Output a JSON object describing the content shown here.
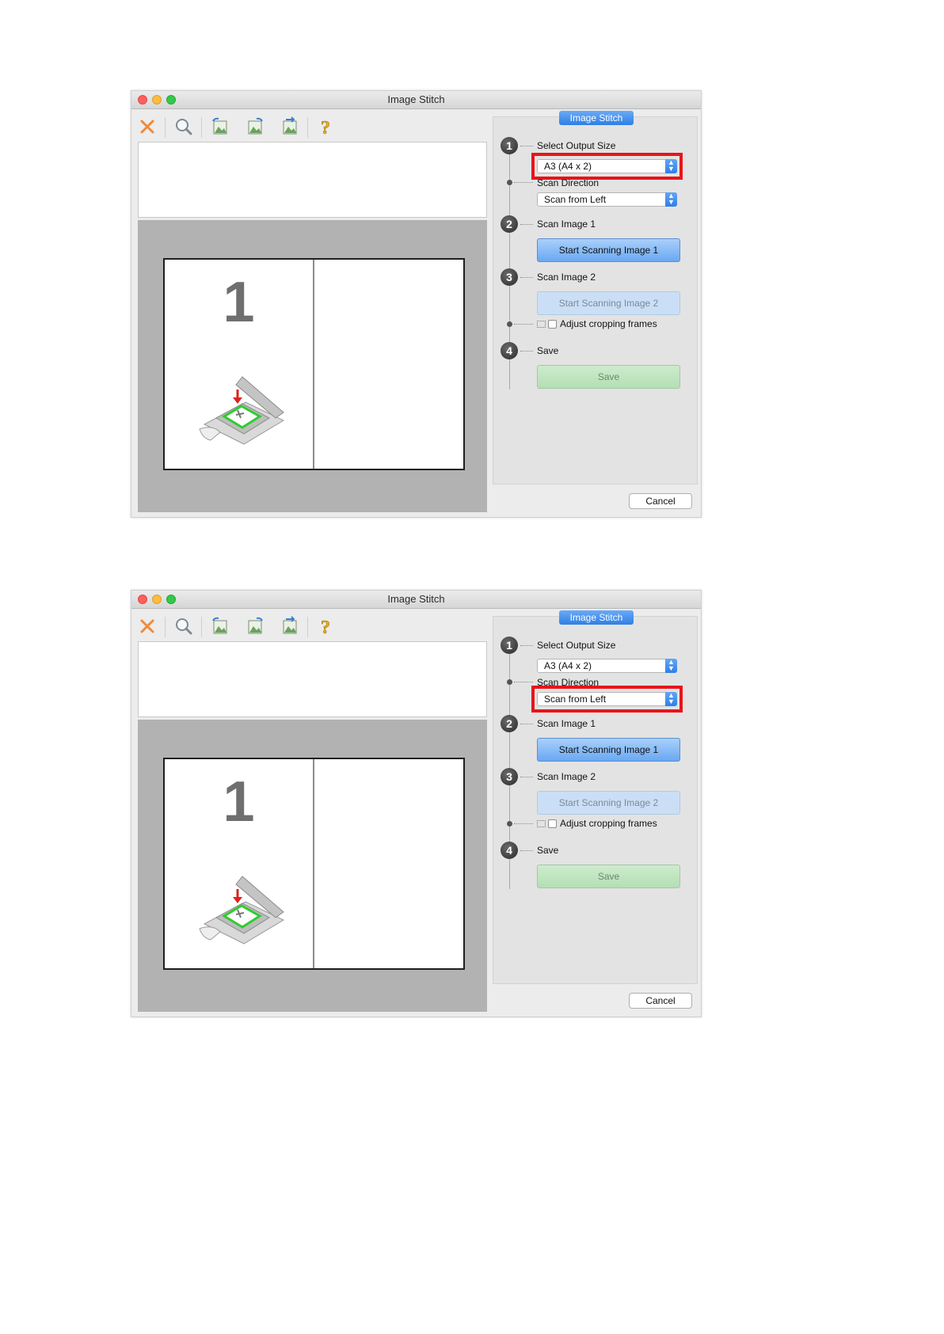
{
  "windows": [
    {
      "title": "Image Stitch",
      "panel_tab": "Image Stitch",
      "preview_page_number": "1",
      "steps": [
        {
          "number": "1",
          "label": "Select Output Size"
        },
        {
          "number": "2",
          "label": "Scan Image 1"
        },
        {
          "number": "3",
          "label": "Scan Image 2"
        },
        {
          "number": "4",
          "label": "Save"
        }
      ],
      "scan_direction_label": "Scan Direction",
      "output_size_value": "A3 (A4 x 2)",
      "scan_direction_value": "Scan from Left",
      "start_scan_1": "Start Scanning Image 1",
      "start_scan_2": "Start Scanning Image 2",
      "adjust_cropping": "Adjust cropping frames",
      "save_button": "Save",
      "cancel_button": "Cancel",
      "highlighted_control": "output-size-select"
    },
    {
      "title": "Image Stitch",
      "panel_tab": "Image Stitch",
      "preview_page_number": "1",
      "steps": [
        {
          "number": "1",
          "label": "Select Output Size"
        },
        {
          "number": "2",
          "label": "Scan Image 1"
        },
        {
          "number": "3",
          "label": "Scan Image 2"
        },
        {
          "number": "4",
          "label": "Save"
        }
      ],
      "scan_direction_label": "Scan Direction",
      "output_size_value": "A3 (A4 x 2)",
      "scan_direction_value": "Scan from Left",
      "start_scan_1": "Start Scanning Image 1",
      "start_scan_2": "Start Scanning Image 2",
      "adjust_cropping": "Adjust cropping frames",
      "save_button": "Save",
      "cancel_button": "Cancel",
      "highlighted_control": "scan-direction-select"
    }
  ],
  "toolbar_icons": [
    "close-icon",
    "zoom-icon",
    "rotate-left-icon",
    "rotate-right-icon",
    "swap-images-icon",
    "help-icon"
  ],
  "colors": {
    "highlight": "#e8141a",
    "accent_blue": "#2e7fe6",
    "close_x": "#ef8a3c",
    "save_green": "#b4dfb4"
  }
}
